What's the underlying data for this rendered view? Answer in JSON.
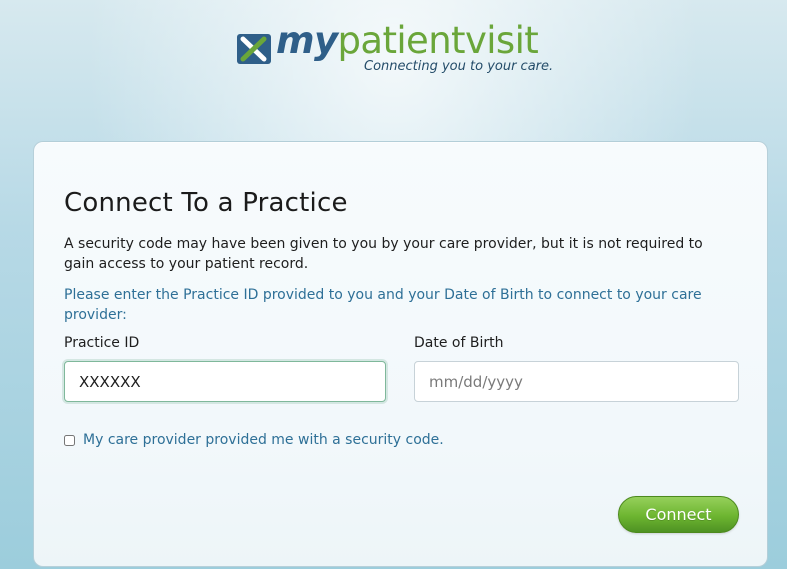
{
  "brand": {
    "logo_text_part1": "my",
    "logo_text_part2": "patientvisit",
    "tagline": "Connecting you to your care.",
    "colors": {
      "primary_blue": "#2f5f89",
      "brand_green": "#6aa63a",
      "instruction_blue": "#2e7097",
      "connect_green": "#6db530"
    }
  },
  "connect_form": {
    "title": "Connect To a Practice",
    "security_note": "A security code may have been given to you by your care provider, but it is not required to gain access to your patient record.",
    "instructions": "Please enter the Practice ID provided to you and your Date of Birth to connect to your care provider:",
    "practice_id": {
      "label": "Practice ID",
      "value": "XXXXXX",
      "placeholder": ""
    },
    "dob": {
      "label": "Date of Birth",
      "value": "",
      "placeholder": "mm/dd/yyyy"
    },
    "security_code_checkbox": {
      "label": "My care provider provided me with a security code.",
      "checked": false
    },
    "connect_label": "Connect"
  },
  "icons": {
    "logo_mark": "mypatientvisit-logo-icon"
  }
}
